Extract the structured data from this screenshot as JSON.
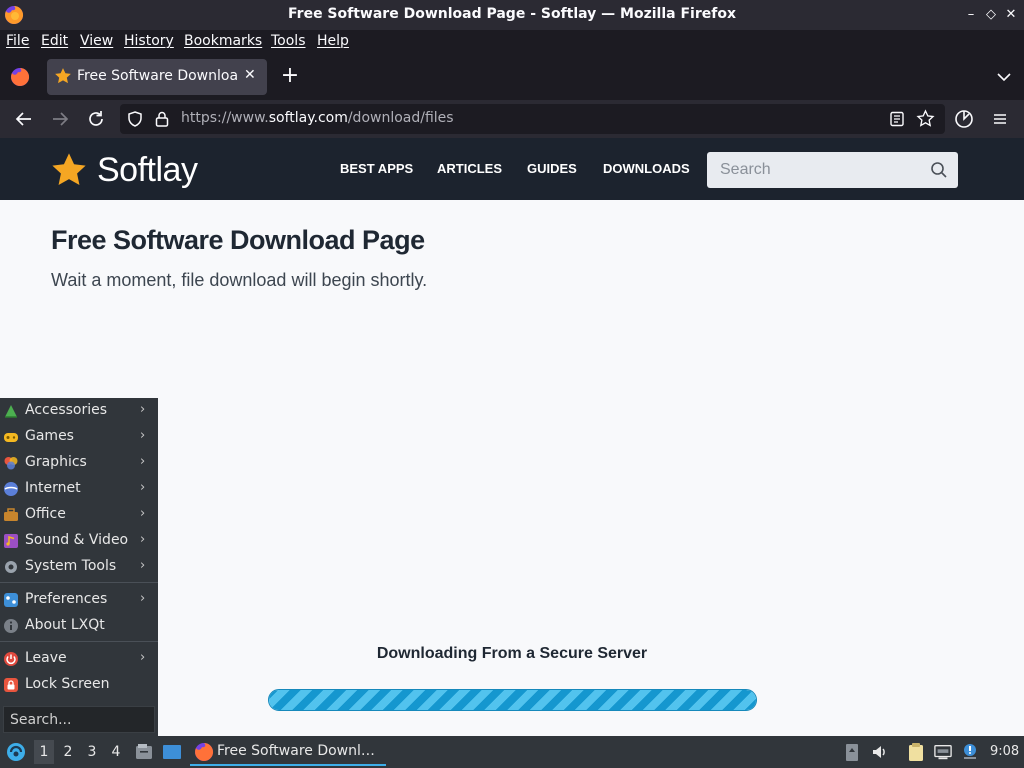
{
  "window": {
    "title": "Free Software Download Page - Softlay — Mozilla Firefox",
    "minimize_glyph": "–",
    "maximize_glyph": "◇",
    "close_glyph": "✕"
  },
  "menubar": [
    "File",
    "Edit",
    "View",
    "History",
    "Bookmarks",
    "Tools",
    "Help"
  ],
  "tab": {
    "title": "Free Software Download Page - Softlay",
    "close_glyph": "✕",
    "new_tab_glyph": "+"
  },
  "urlbar": {
    "prefix": "https://www.",
    "host": "softlay.com",
    "path": "/download/files"
  },
  "site": {
    "logo_text": "Softlay",
    "nav": [
      "BEST APPS",
      "ARTICLES",
      "GUIDES",
      "DOWNLOADS"
    ],
    "search_placeholder": "Search",
    "heading": "Free Software Download Page",
    "subtitle": "Wait a moment, file download will begin shortly.",
    "download_title": "Downloading From a Secure Server",
    "progress_fraction": 1.0
  },
  "start_menu": {
    "categories": [
      {
        "label": "Accessories",
        "icon": "accessories-icon",
        "color": "#4caf50"
      },
      {
        "label": "Games",
        "icon": "games-icon",
        "color": "#f5b921"
      },
      {
        "label": "Graphics",
        "icon": "graphics-icon",
        "color": "#e8553e"
      },
      {
        "label": "Internet",
        "icon": "internet-icon",
        "color": "#5b7fd8"
      },
      {
        "label": "Office",
        "icon": "office-icon",
        "color": "#c7852d"
      },
      {
        "label": "Sound & Video",
        "icon": "sound-video-icon",
        "color": "#9b4fc4"
      },
      {
        "label": "System Tools",
        "icon": "system-tools-icon",
        "color": "#9aa3ad"
      }
    ],
    "prefs": [
      {
        "label": "Preferences",
        "icon": "preferences-icon",
        "has_submenu": true
      },
      {
        "label": "About LXQt",
        "icon": "info-icon",
        "has_submenu": false
      }
    ],
    "session": [
      {
        "label": "Leave",
        "icon": "power-icon",
        "has_submenu": true
      },
      {
        "label": "Lock Screen",
        "icon": "lock-icon",
        "has_submenu": false
      }
    ],
    "search_placeholder": "Search...",
    "arrow_glyph": "›"
  },
  "taskbar": {
    "desktops": [
      "1",
      "2",
      "3",
      "4"
    ],
    "task_label": "Free Software Downl…",
    "clock": "9:08"
  }
}
